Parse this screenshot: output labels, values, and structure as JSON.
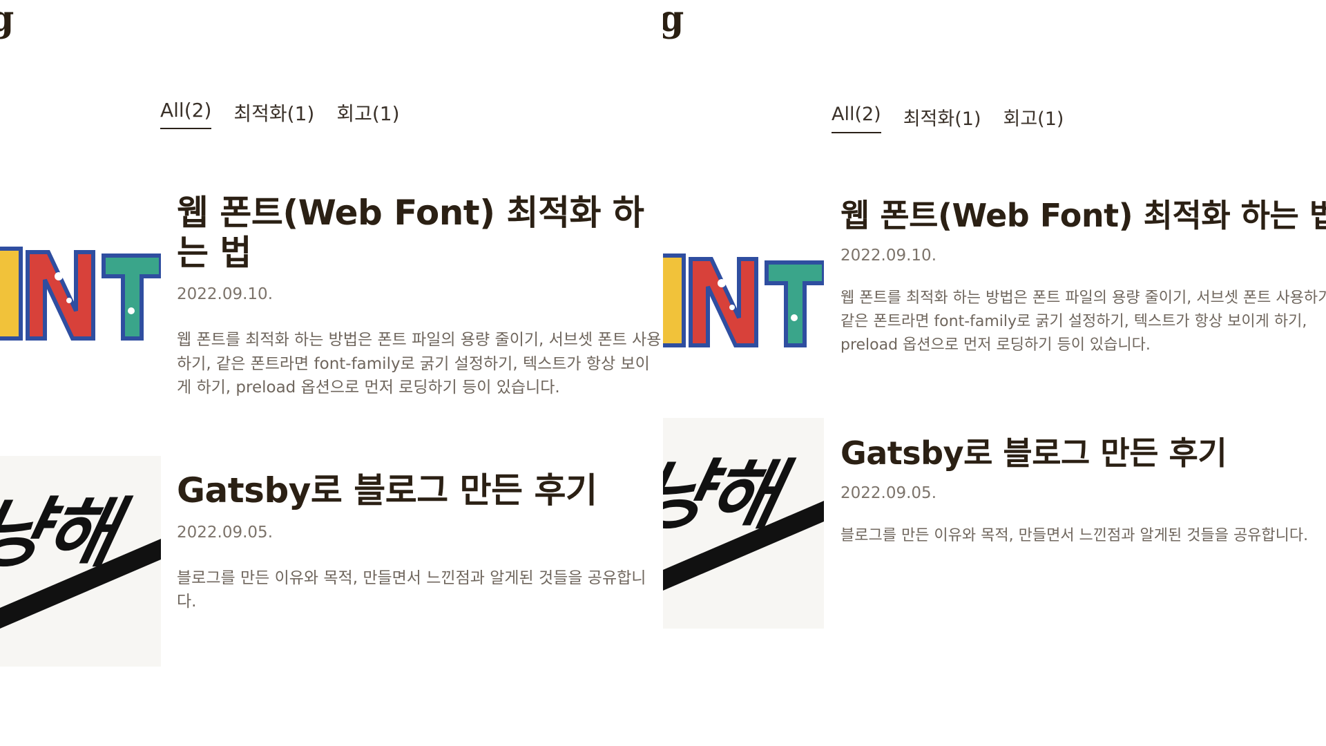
{
  "blog": {
    "logo_text": "g"
  },
  "tabs": [
    {
      "label": "All(2)"
    },
    {
      "label": "최적화(1)"
    },
    {
      "label": "회고(1)"
    }
  ],
  "posts": [
    {
      "title": "웹 폰트(Web Font) 최적화 하는 법",
      "date": "2022.09.10.",
      "description": "웹 폰트를 최적화 하는 방법은 폰트 파일의 용량 줄이기, 서브셋 폰트 사용하기, 같은 폰트라면 font-family로 굵기 설정하기, 텍스트가 항상 보이게 하기, preload 옵션으로 먼저 로딩하기 등이 있습니다.",
      "thumbnail_text": "NT"
    },
    {
      "title": "Gatsby로 블로그 만든 후기",
      "date": "2022.09.05.",
      "description": "블로그를 만든 이유와 목적, 만들면서 느낀점과 알게된 것들을 공유합니다.",
      "thumbnail_text": "냥해"
    }
  ],
  "colors": {
    "text": "#2b2014",
    "muted": "#7c736a",
    "thumb_red": "#d8413a",
    "thumb_blue": "#2f4ea0",
    "thumb_yellow": "#f1c23a",
    "thumb_teal": "#3aa58a"
  }
}
